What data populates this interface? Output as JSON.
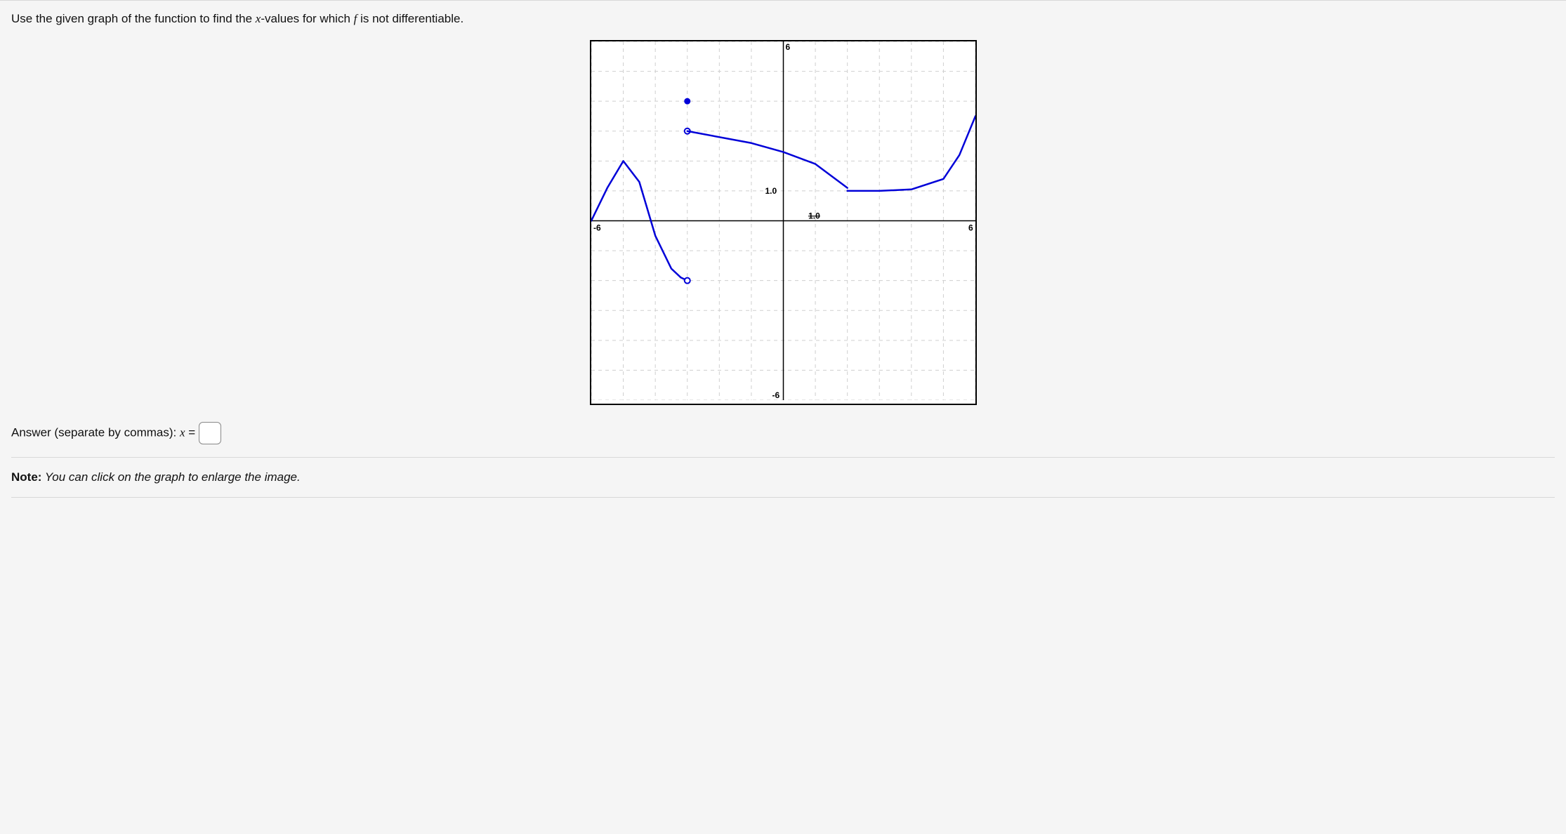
{
  "question": {
    "prefix": "Use the given graph of the function to find the ",
    "var1": "x",
    "mid": "-values for which ",
    "var2": "f",
    "suffix": " is not differentiable."
  },
  "answer": {
    "label_prefix": "Answer (separate by commas): ",
    "var": "x",
    "equals": " = ",
    "value": ""
  },
  "note": {
    "bold": "Note:",
    "italic": " You can click on the graph to enlarge the image."
  },
  "chart_data": {
    "type": "line",
    "title": "",
    "xlabel": "",
    "ylabel": "",
    "xlim": [
      -6,
      6
    ],
    "ylim": [
      -6,
      6
    ],
    "axis_labels": {
      "x_ticks_labeled": [
        -6,
        1.0,
        6
      ],
      "y_ticks_labeled": [
        -6,
        1.0,
        6
      ]
    },
    "grid_step": 1,
    "pieces": [
      {
        "name": "left-hump",
        "x": [
          -6,
          -5.5,
          -5,
          -4.5,
          -4,
          -3.5,
          -3.2,
          -3
        ],
        "y": [
          0,
          1.1,
          2.0,
          1.3,
          -0.5,
          -1.6,
          -1.9,
          -2
        ],
        "end_open_at": [
          -3,
          -2
        ]
      },
      {
        "name": "isolated-point",
        "style": "filled",
        "point": [
          -3,
          4
        ]
      },
      {
        "name": "middle-open-start",
        "style": "open",
        "point": [
          -3,
          3
        ]
      },
      {
        "name": "middle-curve",
        "x": [
          -3,
          -1,
          0,
          1,
          2
        ],
        "y": [
          3,
          2.6,
          2.3,
          1.9,
          1.1
        ]
      },
      {
        "name": "right-curve",
        "x": [
          2,
          3,
          4,
          5,
          5.5,
          6
        ],
        "y": [
          1.0,
          1.0,
          1.05,
          1.4,
          2.2,
          3.5
        ]
      }
    ],
    "non_differentiable_x_candidates": [
      -3,
      2
    ]
  }
}
